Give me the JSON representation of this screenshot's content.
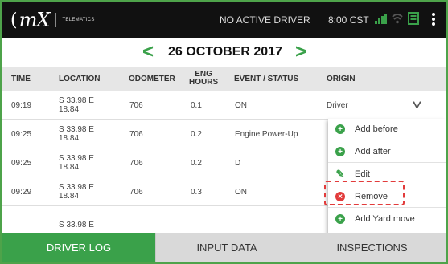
{
  "statusbar": {
    "logo_text": "mX",
    "logo_subtext": "TELEMATICS",
    "driver_status": "NO ACTIVE DRIVER",
    "clock": "8:00 CST",
    "icons": [
      "signal-icon",
      "wifi-icon",
      "device-icon",
      "overflow-menu-icon"
    ],
    "accent_color": "#3aa14a"
  },
  "datebar": {
    "prev_glyph": "<",
    "date": "26 OCTOBER 2017",
    "next_glyph": ">"
  },
  "table": {
    "headers": {
      "time": "TIME",
      "location": "LOCATION",
      "odometer": "ODOMETER",
      "eng_hours_1": "ENG",
      "eng_hours_2": "HOURS",
      "event": "EVENT / STATUS",
      "origin": "ORIGIN"
    },
    "rows": [
      {
        "time": "09:19",
        "loc1": "S 33.98 E",
        "loc2": "18.84",
        "odometer": "706",
        "eng_hours": "0.1",
        "event": "ON",
        "origin": "Driver"
      },
      {
        "time": "09:25",
        "loc1": "S 33.98 E",
        "loc2": "18.84",
        "odometer": "706",
        "eng_hours": "0.2",
        "event": "Engine Power-Up",
        "origin": ""
      },
      {
        "time": "09:25",
        "loc1": "S 33.98 E",
        "loc2": "18.84",
        "odometer": "706",
        "eng_hours": "0.2",
        "event": "D",
        "origin": ""
      },
      {
        "time": "09:29",
        "loc1": "S 33.98 E",
        "loc2": "18.84",
        "odometer": "706",
        "eng_hours": "0.3",
        "event": "ON",
        "origin": ""
      },
      {
        "time": "",
        "loc1": "S 33.98 E",
        "loc2": "",
        "odometer": "",
        "eng_hours": "",
        "event": "",
        "origin": ""
      }
    ]
  },
  "menu": {
    "items": [
      {
        "label": "Add before",
        "icon": "plus-circle-icon",
        "glyph": "+"
      },
      {
        "label": "Add after",
        "icon": "plus-circle-icon",
        "glyph": "+"
      },
      {
        "label": "Edit",
        "icon": "edit-icon",
        "glyph": "✎"
      },
      {
        "label": "Remove",
        "icon": "remove-circle-icon",
        "glyph": "×"
      },
      {
        "label": "Add Yard move",
        "icon": "plus-circle-icon",
        "glyph": "+"
      }
    ],
    "highlighted_item": "Remove",
    "highlight_color": "#e23b3b"
  },
  "tabs": [
    {
      "label": "DRIVER LOG",
      "active": true
    },
    {
      "label": "INPUT DATA",
      "active": false
    },
    {
      "label": "INSPECTIONS",
      "active": false
    }
  ]
}
